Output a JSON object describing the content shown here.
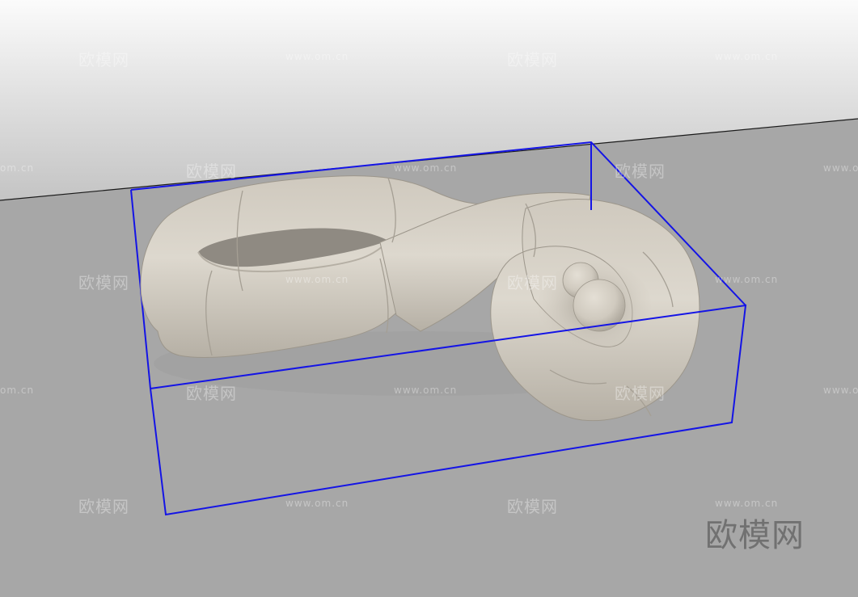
{
  "viewport": {
    "background_top": "#fafafa",
    "background_mid": "#c5c5c5",
    "floor_color": "#a6a6a6",
    "horizon_color": "#1a1a1a",
    "bbox_color": "#1010ee",
    "sofa_color": "#d3cdc2"
  },
  "object": {
    "name": "curved-modular-sofa"
  },
  "watermarks": {
    "brand_cn": "欧模网",
    "site_url": "www.om.cn",
    "site_url_cut": "om.cn",
    "logo_text": "欧模网"
  }
}
